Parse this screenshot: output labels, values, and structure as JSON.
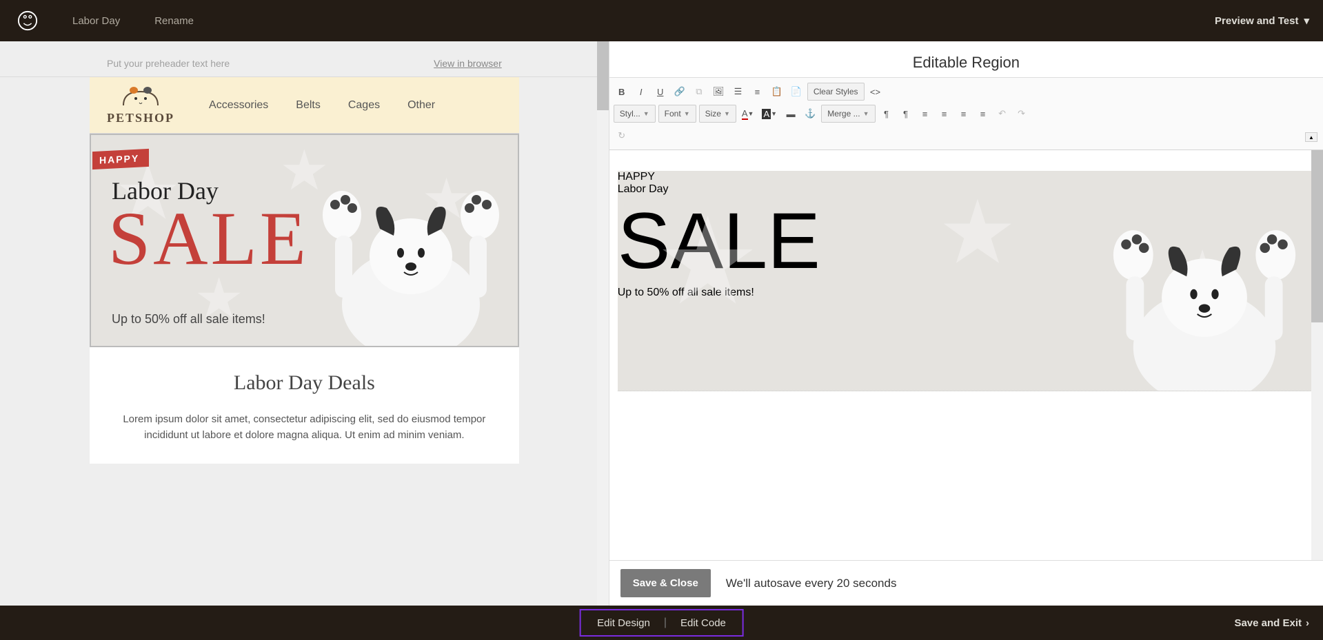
{
  "topbar": {
    "campaign_name": "Labor Day",
    "rename": "Rename",
    "preview": "Preview and Test"
  },
  "preheader": {
    "placeholder": "Put your preheader text here",
    "view_link": "View in browser"
  },
  "brand": {
    "name": "PETSHOP"
  },
  "nav": [
    "Accessories",
    "Belts",
    "Cages",
    "Other"
  ],
  "hero": {
    "ribbon": "HAPPY",
    "script": "Labor Day",
    "sale": "SALE",
    "sub": "Up to 50% off all sale items!"
  },
  "section": {
    "title": "Labor Day Deals",
    "lorem": "Lorem ipsum dolor sit amet, consectetur adipiscing elit, sed do eiusmod tempor incididunt ut labore et dolore magna aliqua. Ut enim ad minim veniam."
  },
  "editor": {
    "title": "Editable Region",
    "toolbar": {
      "clear_styles": "Clear Styles",
      "styles": "Styl...",
      "font": "Font",
      "size": "Size",
      "merge": "Merge ..."
    },
    "save_close": "Save & Close",
    "autosave": "We'll autosave every 20 seconds"
  },
  "bottombar": {
    "edit_design": "Edit Design",
    "edit_code": "Edit Code",
    "save_exit": "Save and Exit"
  }
}
